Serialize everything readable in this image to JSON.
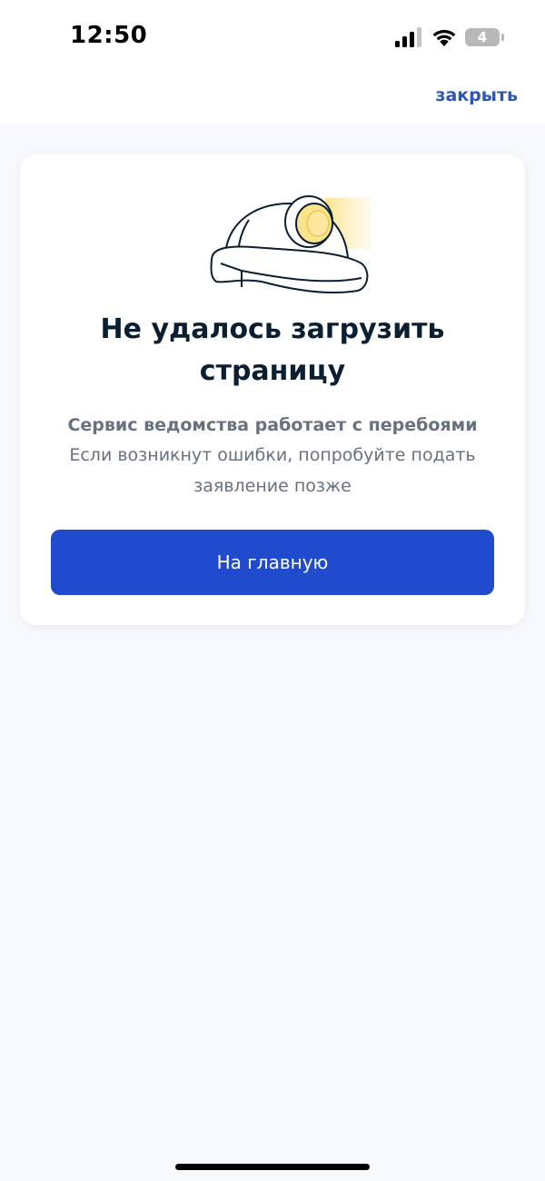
{
  "status_bar": {
    "time": "12:50",
    "battery_level": "4",
    "icons": [
      "signal-icon",
      "wifi-icon",
      "battery-icon"
    ]
  },
  "header": {
    "close_label": "закрыть"
  },
  "error_card": {
    "illustration": "miner-helmet-with-lamp",
    "title": "Не удалось загрузить страницу",
    "subtitle": "Сервис ведомства работает с перебоями",
    "description": "Если возникнут ошибки, попробуйте подать заявление позже",
    "button_label": "На главную"
  },
  "colors": {
    "accent": "#214bcd",
    "link": "#2d55b4",
    "title": "#0b1f33",
    "secondary_text": "#66727f",
    "background": "#f8f9fd",
    "lamp_light": "#fbe38a"
  }
}
